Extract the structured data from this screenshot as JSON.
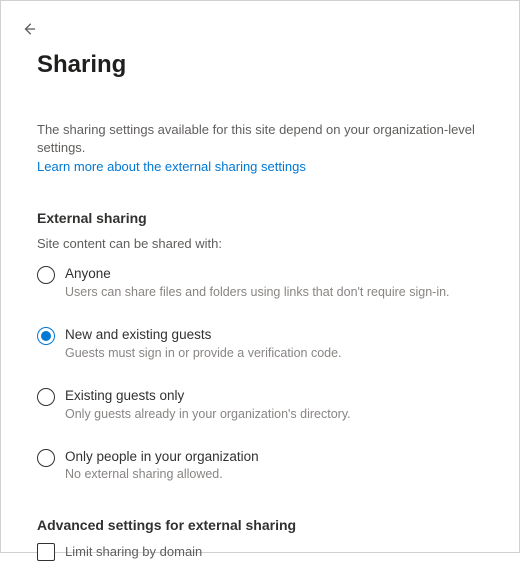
{
  "page": {
    "title": "Sharing",
    "intro": "The sharing settings available for this site depend on your organization-level settings.",
    "learn_more": "Learn more about the external sharing settings"
  },
  "external_sharing": {
    "heading": "External sharing",
    "subtext": "Site content can be shared with:",
    "selected_index": 1,
    "options": [
      {
        "label": "Anyone",
        "description": "Users can share files and folders using links that don't require sign-in."
      },
      {
        "label": "New and existing guests",
        "description": "Guests must sign in or provide a verification code."
      },
      {
        "label": "Existing guests only",
        "description": "Only guests already in your organization's directory."
      },
      {
        "label": "Only people in your organization",
        "description": "No external sharing allowed."
      }
    ]
  },
  "advanced": {
    "heading": "Advanced settings for external sharing",
    "limit_sharing_label": "Limit sharing by domain",
    "limit_sharing_checked": false
  }
}
